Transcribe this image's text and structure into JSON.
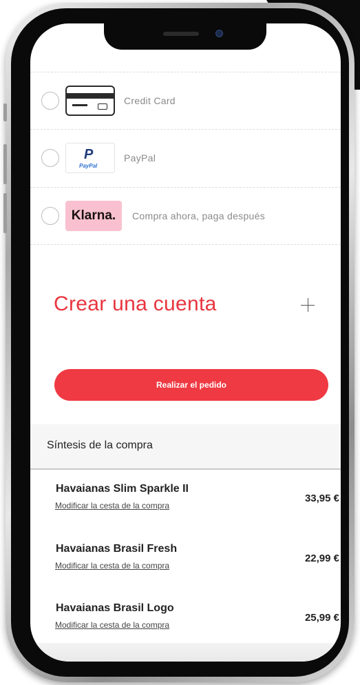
{
  "payment_methods": [
    {
      "id": "credit-card",
      "label": "Credit Card",
      "icon": "credit-card-icon"
    },
    {
      "id": "paypal",
      "label": "PayPal",
      "icon": "paypal-logo",
      "logo_p": "P",
      "logo_text": "PayPal"
    },
    {
      "id": "klarna",
      "label": "Compra ahora, paga después",
      "icon": "klarna-logo",
      "logo_text": "Klarna."
    }
  ],
  "account": {
    "title": "Crear una cuenta",
    "expand_icon": "plus-icon"
  },
  "order_button": {
    "label": "Realizar el pedido"
  },
  "summary": {
    "title": "Síntesis de la compra",
    "link_label": "Modificar la cesta de la compra",
    "products": [
      {
        "name": "Havaianas Slim Sparkle II",
        "price": "33,95 €"
      },
      {
        "name": "Havaianas Brasil Fresh",
        "price": "22,99 €"
      },
      {
        "name": "Havaianas Brasil Logo",
        "price": "25,99 €"
      }
    ]
  },
  "colors": {
    "accent": "#ef3a43",
    "klarna_pink": "#f9c1cf",
    "paypal_blue": "#1f3b7a"
  }
}
